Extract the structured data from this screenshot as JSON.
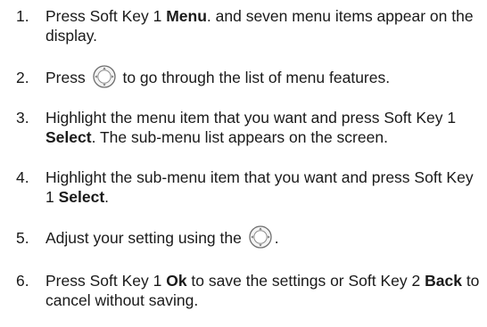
{
  "steps": [
    {
      "number": "1.",
      "parts": [
        {
          "text": "Press Soft Key 1 ",
          "bold": false
        },
        {
          "text": "Menu",
          "bold": true
        },
        {
          "text": ". and seven menu items appear on the display.",
          "bold": false
        }
      ]
    },
    {
      "number": "2.",
      "parts": [
        {
          "text": "Press ",
          "bold": false
        },
        {
          "icon": "navigation-key-icon"
        },
        {
          "text": " to go through the list of menu features.",
          "bold": false
        }
      ]
    },
    {
      "number": "3.",
      "parts": [
        {
          "text": "Highlight the menu item that you want and press Soft Key 1 ",
          "bold": false
        },
        {
          "text": "Select",
          "bold": true
        },
        {
          "text": ". The sub-menu list appears on the screen.",
          "bold": false
        }
      ]
    },
    {
      "number": "4.",
      "parts": [
        {
          "text": "Highlight the sub-menu item that you want and press Soft Key 1 ",
          "bold": false
        },
        {
          "text": "Select",
          "bold": true
        },
        {
          "text": ".",
          "bold": false
        }
      ]
    },
    {
      "number": "5.",
      "parts": [
        {
          "text": "Adjust your setting using the ",
          "bold": false
        },
        {
          "icon": "navigation-key-icon"
        },
        {
          "text": ".",
          "bold": false
        }
      ]
    },
    {
      "number": "6.",
      "parts": [
        {
          "text": "Press Soft Key 1 ",
          "bold": false
        },
        {
          "text": "Ok",
          "bold": true
        },
        {
          "text": " to save the settings or Soft Key 2 ",
          "bold": false
        },
        {
          "text": "Back",
          "bold": true
        },
        {
          "text": " to cancel without saving.",
          "bold": false
        }
      ]
    }
  ]
}
